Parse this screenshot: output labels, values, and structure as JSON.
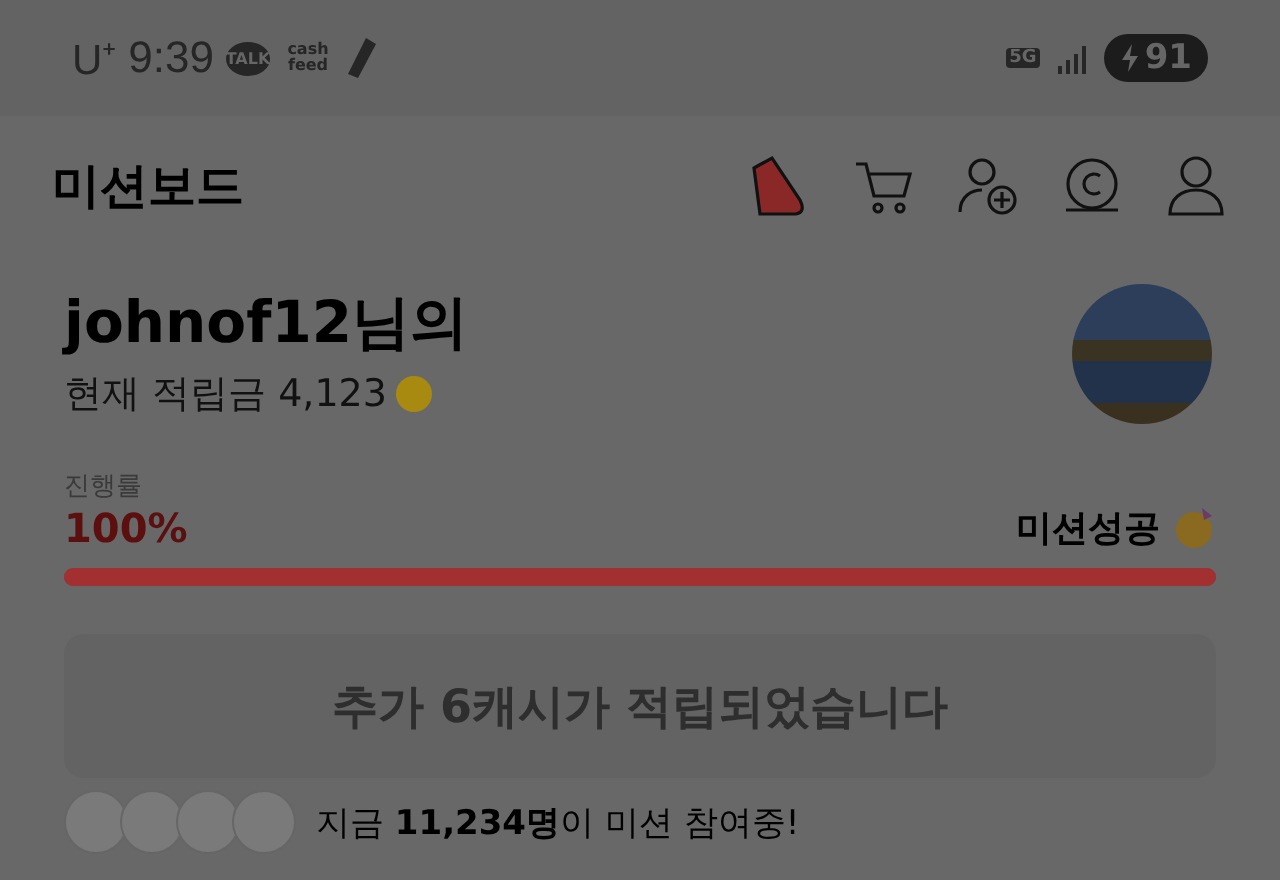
{
  "status_bar": {
    "carrier": "U⁺",
    "time": "9:39",
    "notifications": [
      {
        "kind": "talk",
        "text": "TALK"
      },
      {
        "kind": "cashfeed",
        "text": "cash feed"
      },
      {
        "kind": "shoe"
      }
    ],
    "network": "5G",
    "battery": "91"
  },
  "header": {
    "title": "미션보드",
    "icons": [
      {
        "kind": "shoe"
      },
      {
        "kind": "cart"
      },
      {
        "kind": "add-user"
      },
      {
        "kind": "coin"
      },
      {
        "kind": "user"
      }
    ]
  },
  "profile": {
    "name": "johnof12님의",
    "balance_label": "현재 적립금",
    "balance": "4,123"
  },
  "progress": {
    "label": "진행률",
    "percent": "100%",
    "status": "미션성공",
    "level": 1
  },
  "notice_button": {
    "label": "추가 6캐시가 적립되었습니다",
    "disabled": true
  },
  "participants": {
    "text": "지금 **11,234명**이 미션 참여중!"
  }
}
